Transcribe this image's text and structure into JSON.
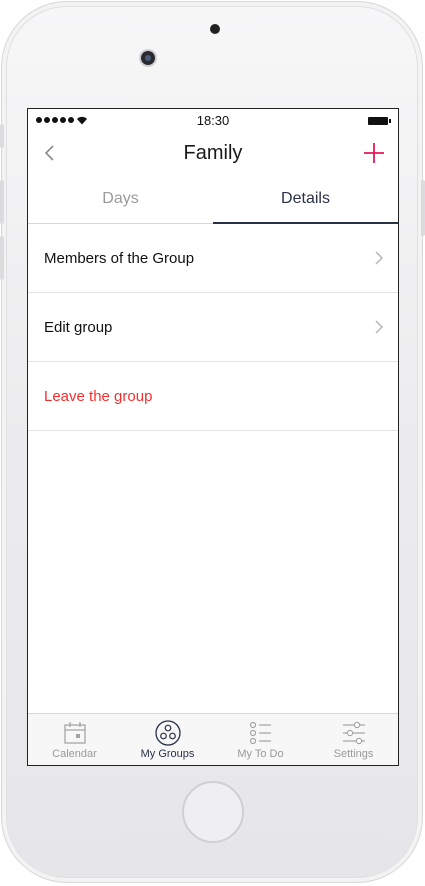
{
  "status_bar": {
    "time": "18:30"
  },
  "nav": {
    "title": "Family"
  },
  "tabs": {
    "days": "Days",
    "details": "Details",
    "active": "details"
  },
  "list": [
    {
      "label": "Members of the Group",
      "has_chevron": true,
      "style": "normal"
    },
    {
      "label": "Edit group",
      "has_chevron": true,
      "style": "normal"
    },
    {
      "label": "Leave the group",
      "has_chevron": false,
      "style": "danger"
    }
  ],
  "tab_bar": [
    {
      "label": "Calendar",
      "icon": "calendar-icon",
      "active": false
    },
    {
      "label": "My Groups",
      "icon": "groups-icon",
      "active": true
    },
    {
      "label": "My To Do",
      "icon": "todo-list-icon",
      "active": false
    },
    {
      "label": "Settings",
      "icon": "settings-sliders-icon",
      "active": false
    }
  ],
  "colors": {
    "accent": "#e8185a",
    "danger": "#f22f2f",
    "active_tab": "#2a3147",
    "inactive": "#9a9a9a"
  }
}
